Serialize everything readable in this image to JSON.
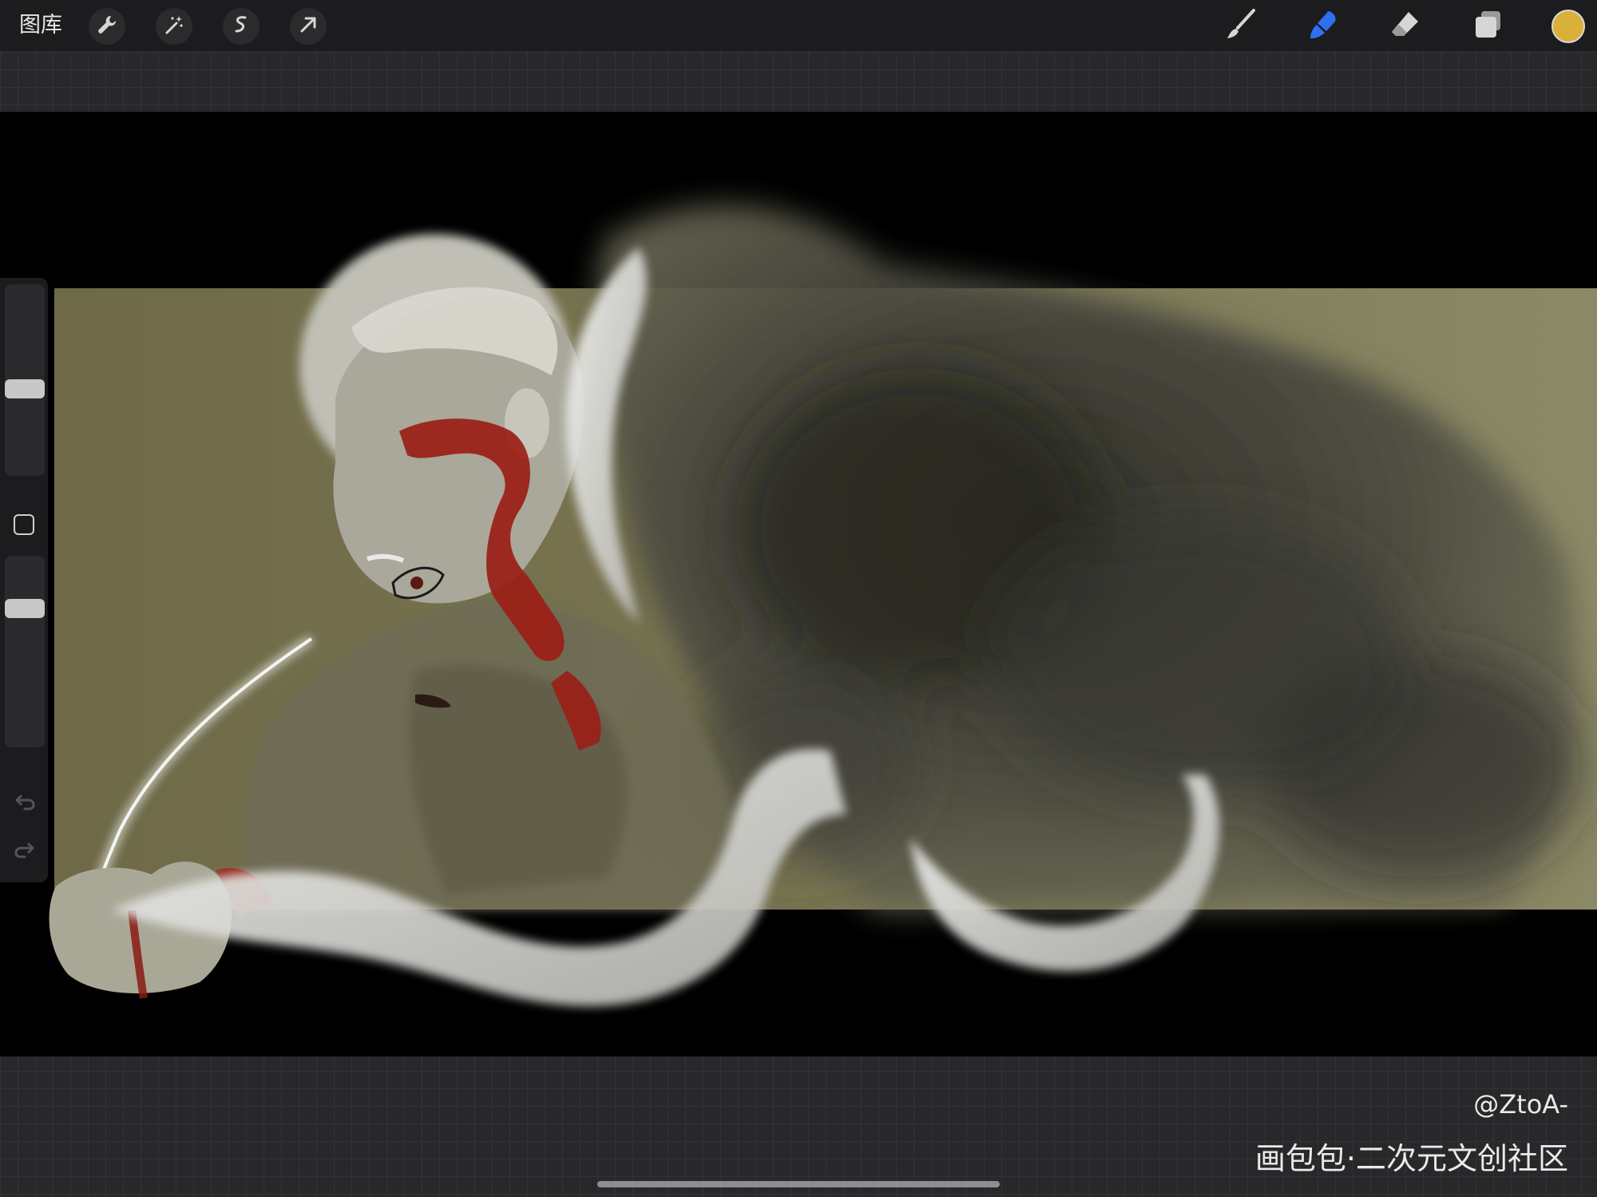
{
  "toolbar": {
    "gallery_label": "图库",
    "left_tools": [
      "wrench-icon",
      "magic-wand-icon",
      "selection-icon",
      "transform-arrow-icon"
    ],
    "right_tools": [
      "brush-icon",
      "smudge-icon",
      "eraser-icon",
      "layers-icon"
    ],
    "active_tool": "smudge-icon",
    "accent_color": "#2f6ff0",
    "current_color": "#d9b13a"
  },
  "canvas": {
    "background": "#000000",
    "artwork_palette": [
      "#7d7a55",
      "#5a5a48",
      "#2f2f2a",
      "#e8e8e4",
      "#9b1e16"
    ]
  },
  "side_panel": {
    "brush_size_level": 0.45,
    "opacity_level": 0.75
  },
  "watermark": {
    "handle": "@ZtoA-",
    "site": "画包包·二次元文创社区"
  }
}
